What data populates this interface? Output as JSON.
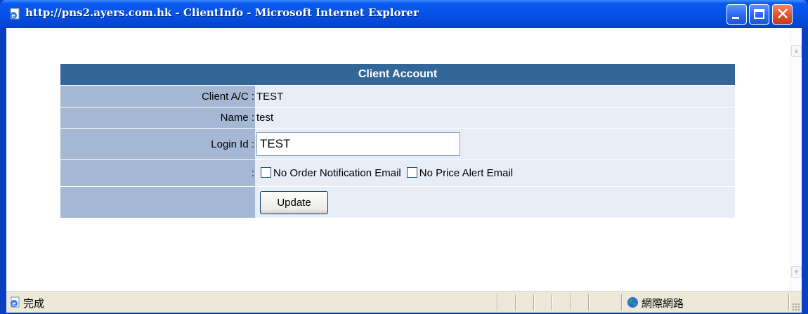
{
  "window": {
    "title": "http://pns2.ayers.com.hk - ClientInfo - Microsoft Internet Explorer",
    "icon": "ie-page-icon",
    "controls": [
      "minimize-icon",
      "maximize-icon",
      "close-icon"
    ]
  },
  "account": {
    "heading": "Client Account",
    "client_ac_label": "Client A/C :",
    "client_ac_value": "TEST",
    "name_label": "Name :",
    "name_value": "test",
    "login_label": "Login Id :",
    "login_value": "TEST",
    "options_label": ":",
    "no_order_email_label": "No Order Notification Email",
    "no_order_email_checked": false,
    "no_price_alert_label": "No Price Alert Email",
    "no_price_alert_checked": false,
    "update_label": "Update"
  },
  "statusbar": {
    "status_text": "完成",
    "zone_text": "網際網路",
    "zone_icon": "globe-icon"
  },
  "colors": {
    "header_bg": "#336699",
    "label_bg": "#a4b8d4",
    "value_bg": "#e8eef7",
    "titlebar": "#0552e6"
  }
}
